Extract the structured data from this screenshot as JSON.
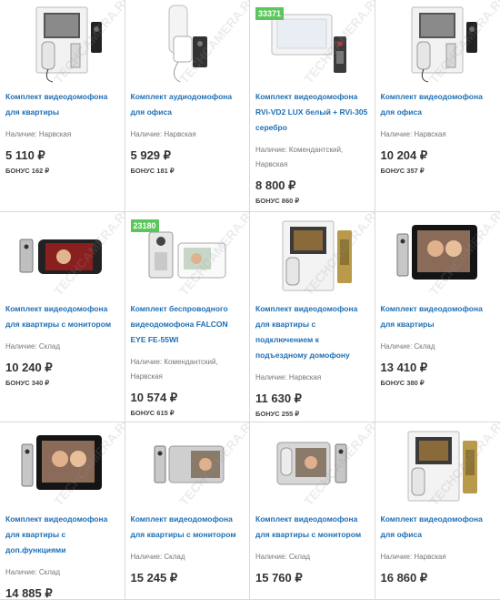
{
  "products": [
    {
      "title": "Комплект видеодомофона для квартиры",
      "availability": "Наличие: Нарвская",
      "price": "5 110 ₽",
      "bonus": "БОНУС 162 ₽",
      "badge": "",
      "image": "monitor-handset-panel"
    },
    {
      "title": "Комплект аудиодомофона для офиса",
      "availability": "Наличие: Нарвская",
      "price": "5 929 ₽",
      "bonus": "БОНУС 181 ₽",
      "badge": "",
      "image": "audio-handset-panel"
    },
    {
      "title": "Комплект видеодомофона RVi-VD2 LUX белый + RVi-305 серебро",
      "availability": "Наличие: Комендантский, Нарвская",
      "price": "8 800 ₽",
      "bonus": "БОНУС 860 ₽",
      "badge": "33371",
      "image": "white-monitor-panel"
    },
    {
      "title": "Комплект видеодомофона для офиса",
      "availability": "Наличие: Нарвская",
      "price": "10 204 ₽",
      "bonus": "БОНУС 357 ₽",
      "badge": "",
      "image": "monitor-handset-panel"
    },
    {
      "title": "Комплект видеодомофона для квартиры с монитором",
      "availability": "Наличие: Склад",
      "price": "10 240 ₽",
      "bonus": "БОНУС 340 ₽",
      "badge": "",
      "image": "wide-monitor-panel"
    },
    {
      "title": "Комплект беспроводного видеодомофона FALCON EYE FE-55WI",
      "availability": "Наличие: Комендантский, Нарвская",
      "price": "10 574 ₽",
      "bonus": "БОНУС 615 ₽",
      "badge": "23180",
      "image": "wireless-kit"
    },
    {
      "title": "Комплект видеодомофона для квартиры с подключением к подъездному домофону",
      "availability": "Наличие: Нарвская",
      "price": "11 630 ₽",
      "bonus": "БОНУС 255 ₽",
      "badge": "",
      "image": "monitor-handset-gold"
    },
    {
      "title": "Комплект видеодомофона для квартиры",
      "availability": "Наличие: Склад",
      "price": "13 410 ₽",
      "bonus": "БОНУС 380 ₽",
      "badge": "",
      "image": "black-monitor-panel"
    },
    {
      "title": "Комплект видеодомофона для квартиры с доп.функциями",
      "availability": "Наличие: Склад",
      "price": "14 885 ₽",
      "bonus": "",
      "badge": "",
      "image": "black-monitor-panel"
    },
    {
      "title": "Комплект видеодомофона для квартиры с монитором",
      "availability": "Наличие: Склад",
      "price": "15 245 ₽",
      "bonus": "",
      "badge": "",
      "image": "silver-monitor-panel"
    },
    {
      "title": "Комплект видеодомофона для квартиры с монитором",
      "availability": "Наличие: Склад",
      "price": "15 760 ₽",
      "bonus": "",
      "badge": "",
      "image": "silver-monitor-handset"
    },
    {
      "title": "Комплект видеодомофона для офиса",
      "availability": "Наличие: Нарвская",
      "price": "16 860 ₽",
      "bonus": "",
      "badge": "",
      "image": "monitor-handset-gold"
    }
  ],
  "watermark": "TECHCAMERA.RU"
}
